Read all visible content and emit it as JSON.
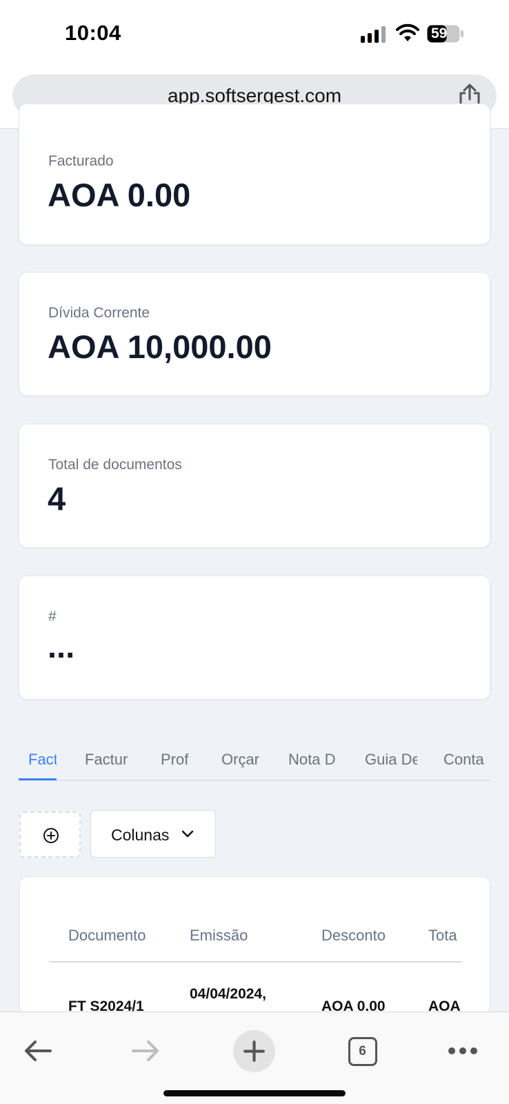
{
  "status_bar": {
    "time": "10:04",
    "battery": "59"
  },
  "browser": {
    "url": "app.softsergest.com"
  },
  "stats": [
    {
      "label": "Facturado",
      "value": "AOA 0.00"
    },
    {
      "label": "Dívida Corrente",
      "value": "AOA 10,000.00"
    },
    {
      "label": "Total de documentos",
      "value": "4"
    },
    {
      "label": "#",
      "value": "..."
    }
  ],
  "tabs": [
    {
      "label": "Fact",
      "active": true
    },
    {
      "label": "Factur"
    },
    {
      "label": "Prof"
    },
    {
      "label": "Orçar"
    },
    {
      "label": "Nota D"
    },
    {
      "label": "Guia De"
    },
    {
      "label": "Conta"
    }
  ],
  "controls": {
    "columns_label": "Colunas"
  },
  "table": {
    "columns": [
      "Documento",
      "Emissão",
      "Desconto",
      "Tota"
    ],
    "rows": [
      {
        "documento": "FT S2024/1",
        "emissao": "04/04/2024,",
        "desconto": "AOA 0.00",
        "total": "AOA"
      }
    ]
  },
  "toolbar": {
    "tab_count": "6"
  },
  "colors": {
    "accent": "#3b82f6",
    "page_bg": "#eff2f7",
    "text_dark": "#131a2b"
  }
}
